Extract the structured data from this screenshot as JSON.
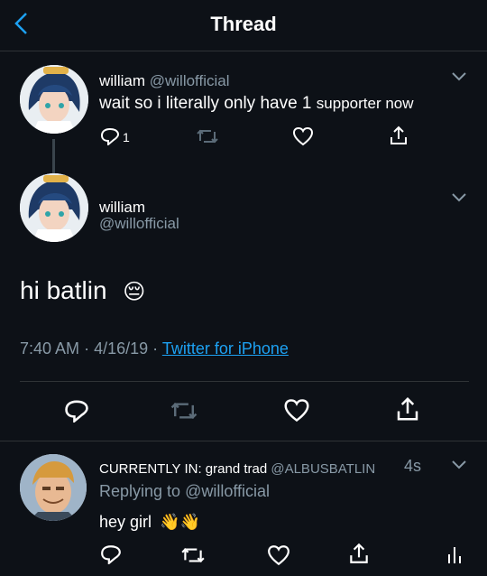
{
  "header": {
    "title": "Thread"
  },
  "tweet1": {
    "name": "william",
    "handle": "@willofficial",
    "text_a": "wait so i literally only have 1",
    "text_b": "supporter now",
    "reply_count": "1"
  },
  "main": {
    "name": "william",
    "handle": "@willofficial",
    "text": "hi batlin",
    "emoji": "😔",
    "time": "7:40 AM",
    "sep1": "·",
    "date": "4/16/19",
    "sep2": "·",
    "source": "Twitter for iPhone"
  },
  "reply": {
    "name": "CURRENTLY IN: grand trad",
    "handle": "@ALBUSBATLIN",
    "age": "4s",
    "replying_label": "Replying to",
    "replying_to": "@willofficial",
    "text": "hey girl",
    "emoji": "👋👋"
  },
  "colors": {
    "accent": "#1da1f2",
    "background": "#0d1117",
    "muted": "#8899a6"
  },
  "icons": [
    "back-chevron-icon",
    "reply-icon",
    "retweet-icon",
    "like-icon",
    "share-icon",
    "analytics-icon",
    "chevron-down-icon"
  ]
}
